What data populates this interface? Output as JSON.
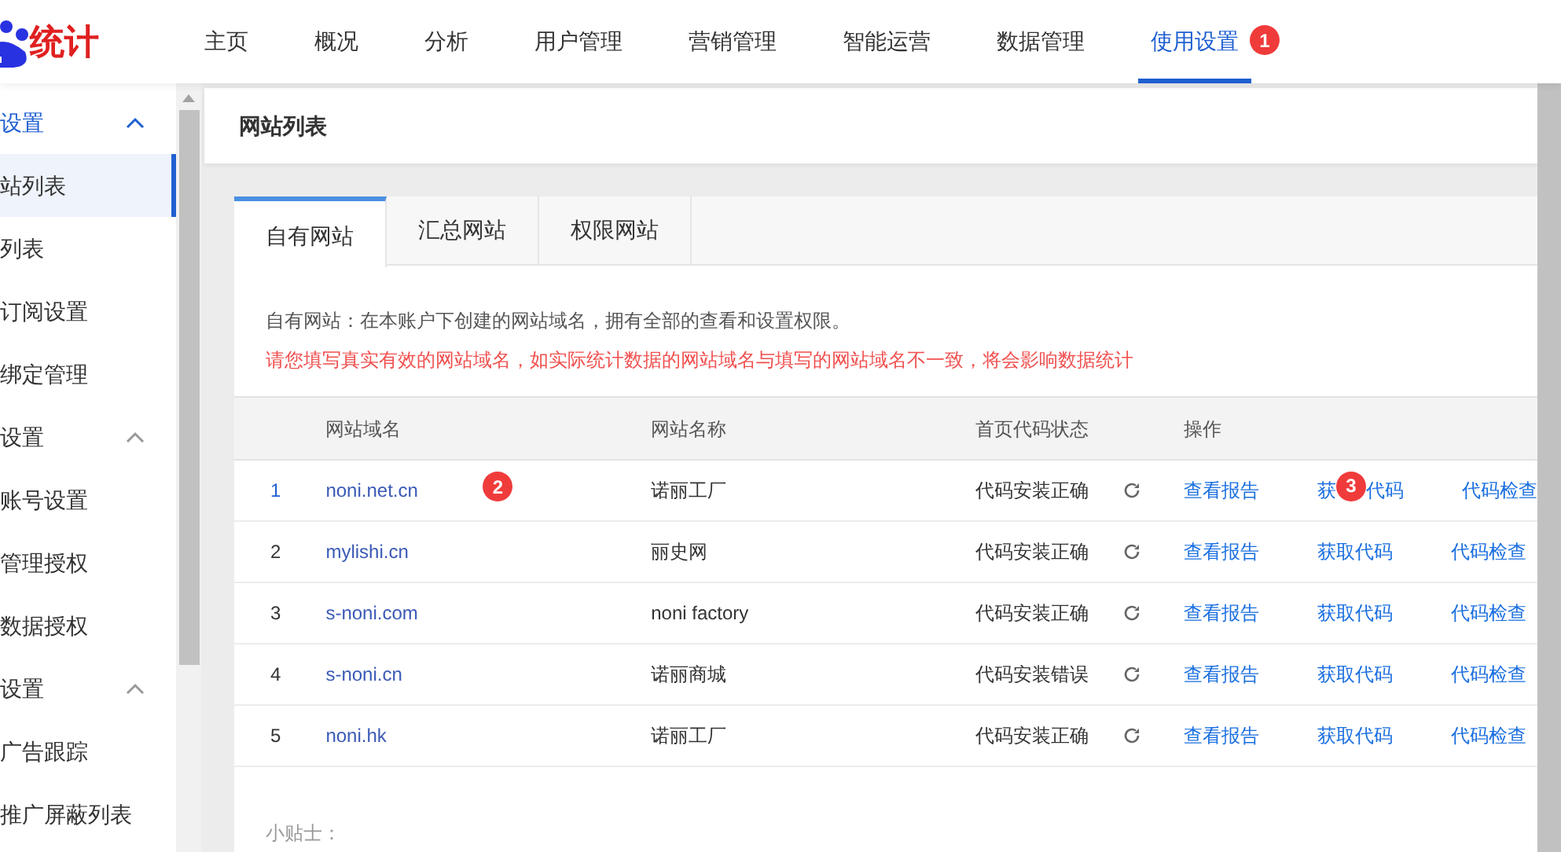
{
  "logo": {
    "text": "统计"
  },
  "nav": [
    {
      "label": "主页",
      "selected": false
    },
    {
      "label": "概况",
      "selected": false
    },
    {
      "label": "分析",
      "selected": false
    },
    {
      "label": "用户管理",
      "selected": false
    },
    {
      "label": "营销管理",
      "selected": false
    },
    {
      "label": "智能运营",
      "selected": false
    },
    {
      "label": "数据管理",
      "selected": false
    },
    {
      "label": "使用设置",
      "selected": true,
      "badge": "1"
    }
  ],
  "sidebar": [
    {
      "label": "设置",
      "expanded": true,
      "children": [
        {
          "label": "站列表",
          "selected": true
        },
        {
          "label": "列表",
          "selected": false
        },
        {
          "label": "订阅设置",
          "selected": false
        },
        {
          "label": "绑定管理",
          "selected": false
        }
      ]
    },
    {
      "label": "设置",
      "expanded": true,
      "children": [
        {
          "label": "账号设置",
          "selected": false
        },
        {
          "label": "管理授权",
          "selected": false
        },
        {
          "label": "数据授权",
          "selected": false
        }
      ]
    },
    {
      "label": "设置",
      "expanded": true,
      "children": [
        {
          "label": "广告跟踪",
          "selected": false
        },
        {
          "label": "推广屏蔽列表",
          "selected": false
        }
      ]
    }
  ],
  "page_title": "网站列表",
  "tabs": [
    {
      "label": "自有网站",
      "selected": true
    },
    {
      "label": "汇总网站",
      "selected": false
    },
    {
      "label": "权限网站",
      "selected": false
    }
  ],
  "description": "自有网站：在本账户下创建的网站域名，拥有全部的查看和设置权限。",
  "warning": "请您填写真实有效的网站域名，如实际统计数据的网站域名与填写的网站域名不一致，将会影响数据统计",
  "table": {
    "columns": [
      "网站域名",
      "网站名称",
      "首页代码状态",
      "操作"
    ],
    "rows": [
      {
        "index": "1",
        "domain": "noni.net.cn",
        "name": "诺丽工厂",
        "status": "代码安装正确",
        "actions": [
          "查看报告",
          {
            "parts": [
              "获",
              "代码"
            ],
            "badge": "3"
          },
          "代码检查"
        ],
        "domain_badge": "2"
      },
      {
        "index": "2",
        "domain": "mylishi.cn",
        "name": "丽史网",
        "status": "代码安装正确",
        "actions": [
          "查看报告",
          "获取代码",
          "代码检查"
        ]
      },
      {
        "index": "3",
        "domain": "s-noni.com",
        "name": "noni factory",
        "status": "代码安装正确",
        "actions": [
          "查看报告",
          "获取代码",
          "代码检查"
        ]
      },
      {
        "index": "4",
        "domain": "s-noni.cn",
        "name": "诺丽商城",
        "status": "代码安装错误",
        "actions": [
          "查看报告",
          "获取代码",
          "代码检查"
        ]
      },
      {
        "index": "5",
        "domain": "noni.hk",
        "name": "诺丽工厂",
        "status": "代码安装正确",
        "actions": [
          "查看报告",
          "获取代码",
          "代码检查"
        ]
      }
    ]
  },
  "tips_title": "小贴士："
}
